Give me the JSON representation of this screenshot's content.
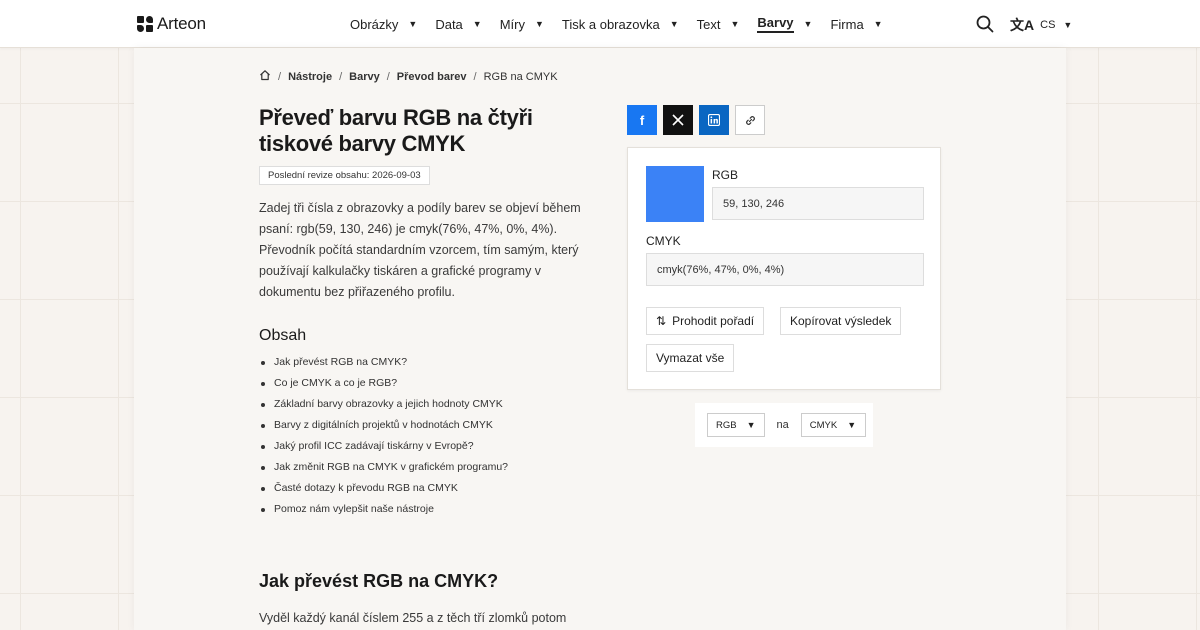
{
  "header": {
    "logo_text": "Arteon",
    "nav": [
      {
        "label": "Obrázky",
        "active": false
      },
      {
        "label": "Data",
        "active": false
      },
      {
        "label": "Míry",
        "active": false
      },
      {
        "label": "Tisk a obrazovka",
        "active": false
      },
      {
        "label": "Text",
        "active": false
      },
      {
        "label": "Barvy",
        "active": true
      },
      {
        "label": "Firma",
        "active": false
      }
    ],
    "language": "CS"
  },
  "breadcrumb": {
    "items": [
      "Nástroje",
      "Barvy",
      "Převod barev"
    ],
    "current": "RGB na CMYK"
  },
  "page": {
    "title": "Převeď barvu RGB na čtyři tiskové barvy CMYK",
    "revision": "Poslední revize obsahu: 2026-09-03",
    "intro": "Zadej tři čísla z obrazovky a podíly barev se objeví během psaní: rgb(59, 130, 246) je cmyk(76%, 47%, 0%, 4%). Převodník počítá standardním vzorcem, tím samým, který používají kalkulačky tiskáren a grafické programy v dokumentu bez přiřazeného profilu."
  },
  "toc": {
    "title": "Obsah",
    "items": [
      "Jak převést RGB na CMYK?",
      "Co je CMYK a co je RGB?",
      "Základní barvy obrazovky a jejich hodnoty CMYK",
      "Barvy z digitálních projektů v hodnotách CMYK",
      "Jaký profil ICC zadávají tiskárny v Evropě?",
      "Jak změnit RGB na CMYK v grafickém programu?",
      "Časté dotazy k převodu RGB na CMYK",
      "Pomoz nám vylepšit naše nástroje"
    ]
  },
  "section": {
    "title": "Jak převést RGB na CMYK?",
    "text": "Vyděl každý kanál číslem 255 a z těch tří zlomků potom"
  },
  "converter": {
    "swatch_color": "#3b82f6",
    "rgb_label": "RGB",
    "rgb_value": "59, 130, 246",
    "cmyk_label": "CMYK",
    "cmyk_value": "cmyk(76%, 47%, 0%, 4%)",
    "swap_label": "Prohodit pořadí",
    "copy_label": "Kopírovat výsledek",
    "clear_label": "Vymazat vše"
  },
  "format": {
    "from": "RGB",
    "connector": "na",
    "to": "CMYK"
  },
  "colors": {
    "facebook": "#1877f2",
    "x": "#111111",
    "linkedin": "#0a66c2"
  }
}
